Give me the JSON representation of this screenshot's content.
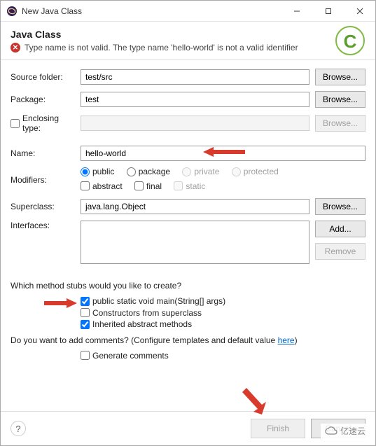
{
  "window": {
    "title": "New Java Class"
  },
  "header": {
    "heading": "Java Class",
    "error": "Type name is not valid. The type name 'hello-world' is not a valid identifier"
  },
  "form": {
    "source_folder_label": "Source folder:",
    "source_folder_value": "test/src",
    "package_label": "Package:",
    "package_value": "test",
    "enclosing_label": "Enclosing type:",
    "enclosing_value": "",
    "name_label": "Name:",
    "name_value": "hello-world",
    "modifiers_label": "Modifiers:",
    "mod_public": "public",
    "mod_package": "package",
    "mod_private": "private",
    "mod_protected": "protected",
    "mod_abstract": "abstract",
    "mod_final": "final",
    "mod_static": "static",
    "superclass_label": "Superclass:",
    "superclass_value": "java.lang.Object",
    "interfaces_label": "Interfaces:"
  },
  "buttons": {
    "browse": "Browse...",
    "add": "Add...",
    "remove": "Remove",
    "finish": "Finish",
    "cancel": "Cancel"
  },
  "stubs": {
    "question": "Which method stubs would you like to create?",
    "main": "public static void main(String[] args)",
    "constructors": "Constructors from superclass",
    "inherited": "Inherited abstract methods"
  },
  "comments": {
    "question_pre": "Do you want to add comments? (Configure templates and default value ",
    "link": "here",
    "question_post": ")",
    "generate": "Generate comments"
  },
  "watermark": "亿速云"
}
